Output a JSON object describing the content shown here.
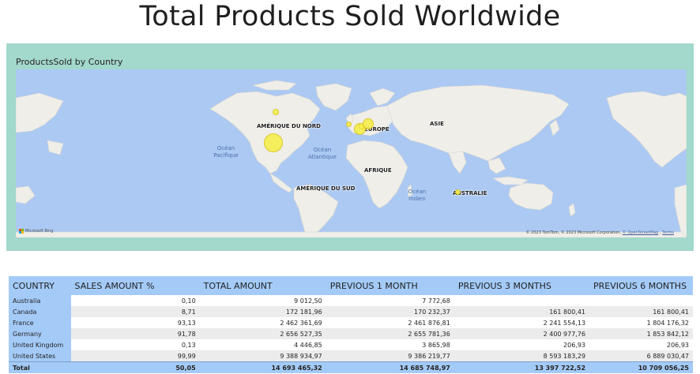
{
  "page": {
    "title": "Total Products Sold Worldwide"
  },
  "map": {
    "title": "ProductsSold by Country",
    "continents": {
      "north_america": "AMÉRIQUE DU NORD",
      "europe": "EUROPE",
      "asia": "ASIE",
      "africa": "AFRIQUE",
      "south_america": "AMÉRIQUE DU SUD",
      "australia": "AUSTRALIE"
    },
    "oceans": {
      "pacific": "Océan Pacifique",
      "atlantic": "Océan Atlantique",
      "indian": "Océan Indien"
    },
    "bing_label": "Microsoft Bing",
    "attribution": "© 2023 TomTom, © 2023 Microsoft Corporation, ",
    "attribution_osm": "© OpenStreetMap",
    "attribution_terms": "Terms",
    "bubble_color": "#f5ee4d",
    "bubbles": [
      {
        "country": "United States",
        "value": 9388934.97
      },
      {
        "country": "Canada",
        "value": 172181.96
      },
      {
        "country": "Germany",
        "value": 2656527.35
      },
      {
        "country": "France",
        "value": 2462361.69
      },
      {
        "country": "United Kingdom",
        "value": 4446.85
      },
      {
        "country": "Australia",
        "value": 9012.5
      }
    ]
  },
  "table": {
    "header_color": "#a4cbf8",
    "columns": [
      "COUNTRY",
      "SALES AMOUNT %",
      "TOTAL AMOUNT",
      "PREVIOUS 1 MONTH",
      "PREVIOUS 3 MONTHS",
      "PREVIOUS 6 MONTHS"
    ],
    "rows": [
      [
        "Australia",
        "0,10",
        "9 012,50",
        "7 772,68",
        "",
        ""
      ],
      [
        "Canada",
        "8,71",
        "172 181,96",
        "170 232,37",
        "161 800,41",
        "161 800,41"
      ],
      [
        "France",
        "93,13",
        "2 462 361,69",
        "2 461 876,81",
        "2 241 554,13",
        "1 804 176,32"
      ],
      [
        "Germany",
        "91,78",
        "2 656 527,35",
        "2 655 781,36",
        "2 400 977,76",
        "1 853 842,12"
      ],
      [
        "United Kingdom",
        "0,13",
        "4 446,85",
        "3 865,98",
        "206,93",
        "206,93"
      ],
      [
        "United States",
        "99,99",
        "9 388 934,97",
        "9 386 219,77",
        "8 593 183,29",
        "6 889 030,47"
      ]
    ],
    "total": [
      "Total",
      "50,05",
      "14 693 465,32",
      "14 685 748,97",
      "13 397 722,52",
      "10 709 056,25"
    ]
  }
}
